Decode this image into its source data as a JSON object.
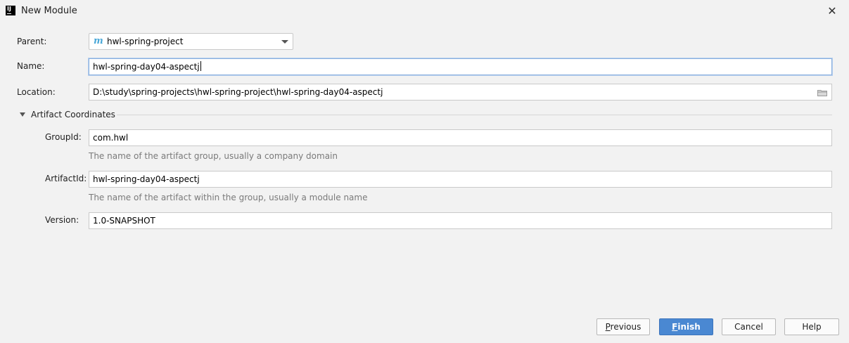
{
  "window": {
    "title": "New Module",
    "app_icon": "intellij-icon",
    "close_glyph": "✕"
  },
  "form": {
    "parent": {
      "label": "Parent:",
      "value": "hwl-spring-project",
      "icon": "maven-module-icon"
    },
    "name": {
      "label": "Name:",
      "value": "hwl-spring-day04-aspectj"
    },
    "location": {
      "label": "Location:",
      "value": "D:\\study\\spring-projects\\hwl-spring-project\\hwl-spring-day04-aspectj",
      "icon": "folder-icon"
    }
  },
  "artifact": {
    "section_title": "Artifact Coordinates",
    "group_id": {
      "label": "GroupId:",
      "value": "com.hwl",
      "hint": "The name of the artifact group, usually a company domain"
    },
    "artifact_id": {
      "label": "ArtifactId:",
      "value": "hwl-spring-day04-aspectj",
      "hint": "The name of the artifact within the group, usually a module name"
    },
    "version": {
      "label": "Version:",
      "value": "1.0-SNAPSHOT"
    }
  },
  "buttons": {
    "previous": {
      "mnemonic": "P",
      "rest": "revious"
    },
    "finish": {
      "mnemonic": "F",
      "rest": "inish"
    },
    "cancel": "Cancel",
    "help": "Help"
  },
  "colors": {
    "primary_button": "#4a88d2",
    "focus_border": "#8ab0de",
    "maven_icon": "#4aa8d8"
  }
}
